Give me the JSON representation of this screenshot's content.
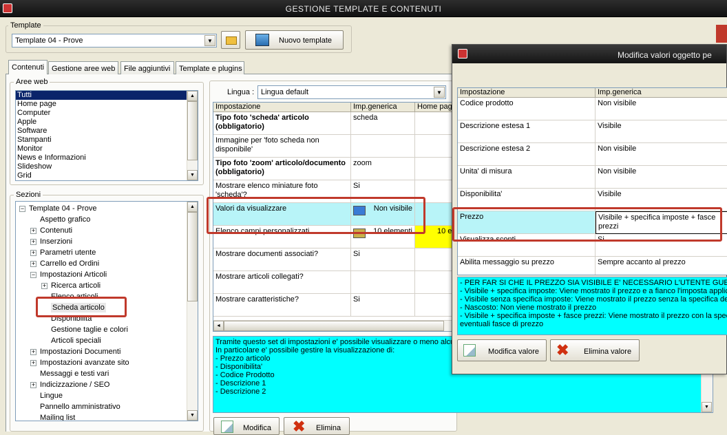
{
  "window": {
    "title": "GESTIONE TEMPLATE E CONTENUTI"
  },
  "template_group": {
    "label": "Template",
    "selected": "Template 04 - Prove",
    "new_button": "Nuovo template"
  },
  "tabs": [
    "Contenuti",
    "Gestione aree web",
    "File aggiuntivi",
    "Template e plugins"
  ],
  "aree_web": {
    "label": "Aree web",
    "items": [
      "Tutti",
      "Home page",
      "Computer",
      "Apple",
      "Software",
      "Stampanti",
      "Monitor",
      "News e Informazioni",
      "Slideshow",
      "Grid"
    ]
  },
  "sezioni": {
    "label": "Sezioni",
    "nodes": [
      {
        "label": "Template 04 - Prove",
        "exp": "-"
      },
      {
        "label": "Aspetto grafico",
        "exp": ""
      },
      {
        "label": "Contenuti",
        "exp": "+"
      },
      {
        "label": "Inserzioni",
        "exp": "+"
      },
      {
        "label": "Parametri utente",
        "exp": "+"
      },
      {
        "label": "Carrello ed Ordini",
        "exp": "+"
      },
      {
        "label": "Impostazioni Articoli",
        "exp": "-"
      },
      {
        "label": "Ricerca articoli",
        "exp": "+"
      },
      {
        "label": "Elenco articoli",
        "exp": ""
      },
      {
        "label": "Scheda articolo",
        "exp": ""
      },
      {
        "label": "Disponibilita'",
        "exp": ""
      },
      {
        "label": "Gestione taglie e colori",
        "exp": ""
      },
      {
        "label": "Articoli speciali",
        "exp": ""
      },
      {
        "label": "Impostazioni Documenti",
        "exp": "+"
      },
      {
        "label": "Impostazioni avanzate sito",
        "exp": "+"
      },
      {
        "label": "Messaggi e testi vari",
        "exp": ""
      },
      {
        "label": "Indicizzazione / SEO",
        "exp": "+"
      },
      {
        "label": "Lingue",
        "exp": ""
      },
      {
        "label": "Pannello amministrativo",
        "exp": ""
      },
      {
        "label": "Mailing list",
        "exp": ""
      }
    ]
  },
  "lingua": {
    "label": "Lingua :",
    "selected": "Lingua default"
  },
  "main_grid": {
    "headers": [
      "Impostazione",
      "Imp.generica",
      "Home page"
    ],
    "rows": [
      {
        "name": "Tipo foto 'scheda' articolo (obbligatorio)",
        "bold": true,
        "value": "scheda",
        "home": ""
      },
      {
        "name": "Immagine per 'foto scheda non disponibile'",
        "bold": false,
        "value": "",
        "home": ""
      },
      {
        "name": "Tipo foto 'zoom' articolo/documento (obbligatorio)",
        "bold": true,
        "value": "zoom",
        "home": ""
      },
      {
        "name": "Mostrare elenco miniature foto 'scheda'?",
        "bold": false,
        "value": "Si",
        "home": ""
      },
      {
        "name": "Valori da visualizzare",
        "bold": false,
        "value": "Non visibile",
        "home": ""
      },
      {
        "name": "Elenco campi personalizzati",
        "bold": false,
        "value": "10 elementi",
        "home": "10 e"
      },
      {
        "name": "Mostrare documenti associati?",
        "bold": false,
        "value": "Si",
        "home": ""
      },
      {
        "name": "Mostrare articoli collegati?",
        "bold": false,
        "value": "",
        "home": ""
      },
      {
        "name": "Mostrare caratteristiche?",
        "bold": false,
        "value": "Si",
        "home": ""
      }
    ]
  },
  "description": {
    "lines": [
      "Tramite questo set di impostazioni e' possibile visualizzare o meno alcuni",
      "In particolare e' possibile gestire la visualizzazione di:",
      "- Prezzo articolo",
      "- Disponibilita'",
      "- Codice Prodotto",
      "- Descrizione 1",
      "- Descrizione 2"
    ]
  },
  "main_buttons": {
    "edit": "Modifica",
    "delete": "Elimina"
  },
  "dialog": {
    "title": "Modifica valori oggetto pe",
    "headers": [
      "Impostazione",
      "Imp.generica"
    ],
    "rows": [
      {
        "name": "Codice prodotto",
        "value": "Non visibile"
      },
      {
        "name": "Descrizione estesa 1",
        "value": "Visibile"
      },
      {
        "name": "Descrizione estesa 2",
        "value": "Non visibile"
      },
      {
        "name": "Unita' di misura",
        "value": "Non visibile"
      },
      {
        "name": "Disponibilita'",
        "value": "Visibile"
      },
      {
        "name": "Prezzo",
        "value": "Visibile + specifica imposte + fasce prezzi"
      },
      {
        "name": "Visualizza sconti",
        "value": "Si"
      },
      {
        "name": "Abilita messaggio su prezzo",
        "value": "Sempre accanto al prezzo"
      }
    ],
    "info": [
      "- PER FAR SI CHE IL PREZZO SIA VISIBILE E' NECESSARIO L'UTENTE GUEST/LOGO",
      "- Visibile + specifica imposte: Viene mostrato il prezzo e a fianco l'imposta applicata",
      "- Visibile senza specifica imposte: Viene mostrato il prezzo senza la specifica dell'im",
      "- Nascosto: Non viene mostrato il prezzo",
      "- Visibile + specifica imposte + fasce prezzi: Viene mostrato il prezzo con la specific",
      "eventuali fasce di prezzo"
    ],
    "edit_button": "Modifica valore",
    "delete_button": "Elimina valore"
  }
}
